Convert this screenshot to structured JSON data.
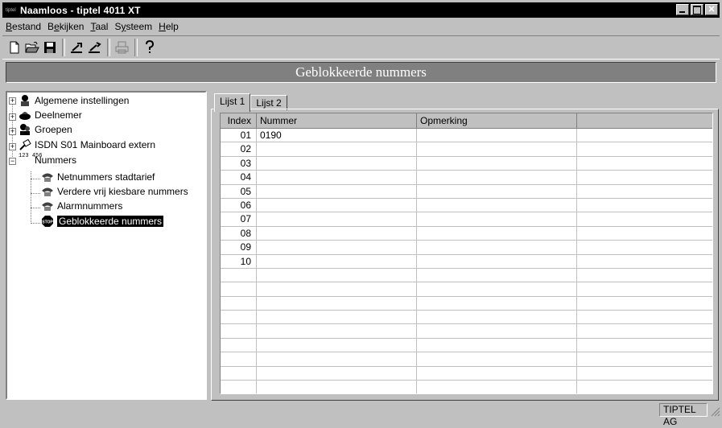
{
  "window": {
    "app_icon_text": "tiptel",
    "title": "Naamloos - tiptel 4011 XT",
    "close_glyph": "✕"
  },
  "menu": [
    {
      "label": "Bestand",
      "accel": "B",
      "rest": "estand"
    },
    {
      "label": "Bekijken",
      "accel": "e",
      "pre": "B",
      "rest": "kijken"
    },
    {
      "label": "Taal",
      "accel": "T",
      "rest": "aal"
    },
    {
      "label": "Systeem",
      "pre": "S",
      "accel": "y",
      "rest": "steem"
    },
    {
      "label": "Help",
      "accel": "H",
      "rest": "elp"
    }
  ],
  "toolbar": [
    "new-file-icon",
    "open-folder-icon",
    "save-icon",
    "upload-icon",
    "download-icon",
    "print-icon",
    "help-icon"
  ],
  "banner": {
    "title": "Geblokkeerde nummers"
  },
  "tree": {
    "items": [
      {
        "label": "Algemene instellingen",
        "icon": "settings-person-icon"
      },
      {
        "label": "Deelnemer",
        "icon": "subscriber-icon"
      },
      {
        "label": "Groepen",
        "icon": "group-icon"
      },
      {
        "label": "ISDN S01 Mainboard extern",
        "icon": "isdn-plug-icon"
      },
      {
        "label": "Nummers",
        "icon": "numbers-icon",
        "icon_text": "123 456"
      },
      {
        "label": "Netnummers stadtarief",
        "icon": "phone-hand-icon"
      },
      {
        "label": "Verdere vrij kiesbare nummers",
        "icon": "phone-hand-icon"
      },
      {
        "label": "Alarmnummers",
        "icon": "phone-hand-icon"
      },
      {
        "label": "Geblokkeerde nummers",
        "icon": "stop-sign-icon",
        "icon_text": "STOP",
        "selected": true
      }
    ]
  },
  "tabs": [
    {
      "label": "Lijst 1",
      "active": true
    },
    {
      "label": "Lijst 2",
      "active": false
    }
  ],
  "grid": {
    "headers": {
      "index": "Index",
      "nummer": "Nummer",
      "opmerking": "Opmerking",
      "extra": ""
    },
    "rows": [
      {
        "index": "01",
        "nummer": "0190",
        "opmerking": ""
      },
      {
        "index": "02",
        "nummer": "",
        "opmerking": ""
      },
      {
        "index": "03",
        "nummer": "",
        "opmerking": ""
      },
      {
        "index": "04",
        "nummer": "",
        "opmerking": ""
      },
      {
        "index": "05",
        "nummer": "",
        "opmerking": ""
      },
      {
        "index": "06",
        "nummer": "",
        "opmerking": ""
      },
      {
        "index": "07",
        "nummer": "",
        "opmerking": ""
      },
      {
        "index": "08",
        "nummer": "",
        "opmerking": ""
      },
      {
        "index": "09",
        "nummer": "",
        "opmerking": ""
      },
      {
        "index": "10",
        "nummer": "",
        "opmerking": ""
      }
    ],
    "empty_rows": 9
  },
  "status": {
    "company": "TIPTEL AG"
  }
}
